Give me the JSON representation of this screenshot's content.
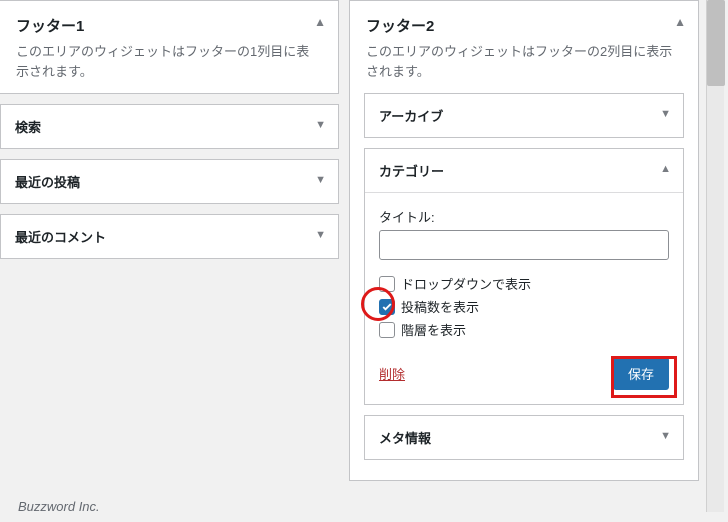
{
  "footer1": {
    "title": "フッター1",
    "description": "このエリアのウィジェットはフッターの1列目に表示されます。",
    "widgets": [
      {
        "label": "検索"
      },
      {
        "label": "最近の投稿"
      },
      {
        "label": "最近のコメント"
      }
    ]
  },
  "footer2": {
    "title": "フッター2",
    "description": "このエリアのウィジェットはフッターの2列目に表示されます。",
    "widgets": {
      "archive": {
        "label": "アーカイブ"
      },
      "category": {
        "label": "カテゴリー",
        "title_field_label": "タイトル:",
        "title_value": "",
        "opt_dropdown": "ドロップダウンで表示",
        "opt_count": "投稿数を表示",
        "opt_hierarchy": "階層を表示",
        "delete": "削除",
        "save": "保存"
      },
      "meta": {
        "label": "メタ情報"
      }
    }
  },
  "credit": "Buzzword Inc."
}
